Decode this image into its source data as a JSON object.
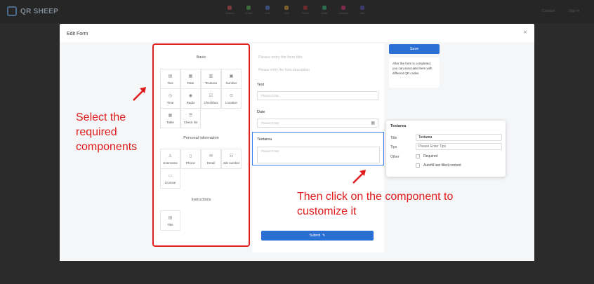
{
  "app": {
    "logo_text": "QR SHEEP",
    "top_nav": [
      {
        "label": "Button",
        "color": "#7a3b3b"
      },
      {
        "label": "Sheet",
        "color": "#3b6b3b"
      },
      {
        "label": "Link",
        "color": "#3b4b7a"
      },
      {
        "label": "Text",
        "color": "#7a5b2b"
      },
      {
        "label": "Form",
        "color": "#6b2b2b"
      },
      {
        "label": "Data",
        "color": "#2b6b4b"
      },
      {
        "label": "Contact",
        "color": "#7a2b4b"
      },
      {
        "label": "Site",
        "color": "#3b3b6b"
      }
    ],
    "top_right_1": "Console",
    "top_right_2": "Sign in"
  },
  "modal": {
    "title": "Edit Form",
    "close": "×"
  },
  "palette": {
    "basic_title": "Basic",
    "basic_items": [
      {
        "label": "Text",
        "icon": "▤"
      },
      {
        "label": "Date",
        "icon": "▦"
      },
      {
        "label": "Textarea",
        "icon": "▥"
      },
      {
        "label": "Number",
        "icon": "▣"
      },
      {
        "label": "Time",
        "icon": "◷"
      },
      {
        "label": "Radio",
        "icon": "◉"
      },
      {
        "label": "Checkbox",
        "icon": "☑"
      },
      {
        "label": "Location",
        "icon": "⊙"
      },
      {
        "label": "Table",
        "icon": "▦"
      },
      {
        "label": "Check list",
        "icon": "☰"
      }
    ],
    "personal_title": "Personal information",
    "personal_items": [
      {
        "label": "Username",
        "icon": "♙"
      },
      {
        "label": "Phone",
        "icon": "▯"
      },
      {
        "label": "Email",
        "icon": "✉"
      },
      {
        "label": "Job number",
        "icon": "☷"
      },
      {
        "label": "License",
        "icon": "▭"
      }
    ],
    "instructions_title": "Instructions",
    "instruction_items": [
      {
        "label": "Title",
        "icon": "▤"
      }
    ]
  },
  "form": {
    "title_placeholder": "Please entry the form title",
    "desc_placeholder": "Please entry the form description",
    "text_label": "Text",
    "text_placeholder": "Please Enter",
    "date_label": "Date",
    "date_placeholder": "Please Enter",
    "textarea_label": "Textarea",
    "textarea_placeholder": "Please Enter",
    "submit_label": "Submit"
  },
  "side": {
    "save_label": "Save",
    "hint": "After the form is completed, you can associate them with different QR codes"
  },
  "props": {
    "heading": "Textarea",
    "title_label": "Title",
    "title_value": "Textarea",
    "tips_label": "Tips",
    "tips_placeholder": "Please Enter Tips",
    "other_label": "Other",
    "required_label": "Required",
    "autofill_label": "Autofill last filled content"
  },
  "annotations": {
    "left": "Select the required components",
    "right": "Then click on the component to customize it"
  }
}
